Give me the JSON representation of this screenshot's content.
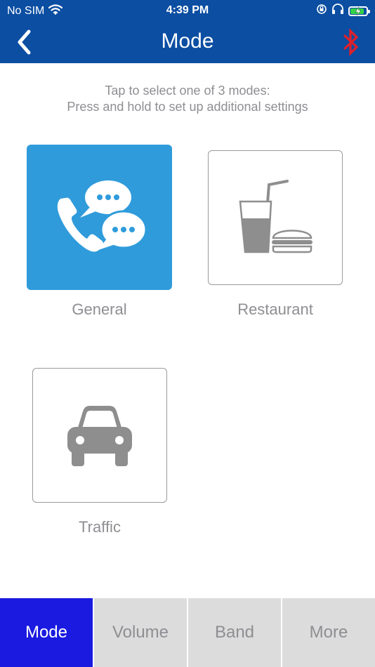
{
  "status_bar": {
    "carrier": "No SIM",
    "time": "4:39 PM",
    "battery_level": 0.85
  },
  "nav": {
    "title": "Mode",
    "back_icon": "chevron-left-icon",
    "bluetooth_icon": "bluetooth-icon",
    "bluetooth_color": "#e0202a"
  },
  "instructions": {
    "line1": "Tap to select one of 3 modes:",
    "line2": "Press and hold to set up additional settings"
  },
  "modes": [
    {
      "label": "General",
      "icon": "phone-chat-icon",
      "selected": true
    },
    {
      "label": "Restaurant",
      "icon": "drink-burger-icon",
      "selected": false
    },
    {
      "label": "Traffic",
      "icon": "car-icon",
      "selected": false
    }
  ],
  "tabs": [
    {
      "label": "Mode",
      "active": true
    },
    {
      "label": "Volume",
      "active": false
    },
    {
      "label": "Band",
      "active": false
    },
    {
      "label": "More",
      "active": false
    }
  ],
  "colors": {
    "header": "#0b4ea2",
    "selected_tile": "#2f9bdb",
    "active_tab": "#1a1ae0",
    "inactive_tab": "#dcdcdc",
    "muted_text": "#8e8e93"
  }
}
